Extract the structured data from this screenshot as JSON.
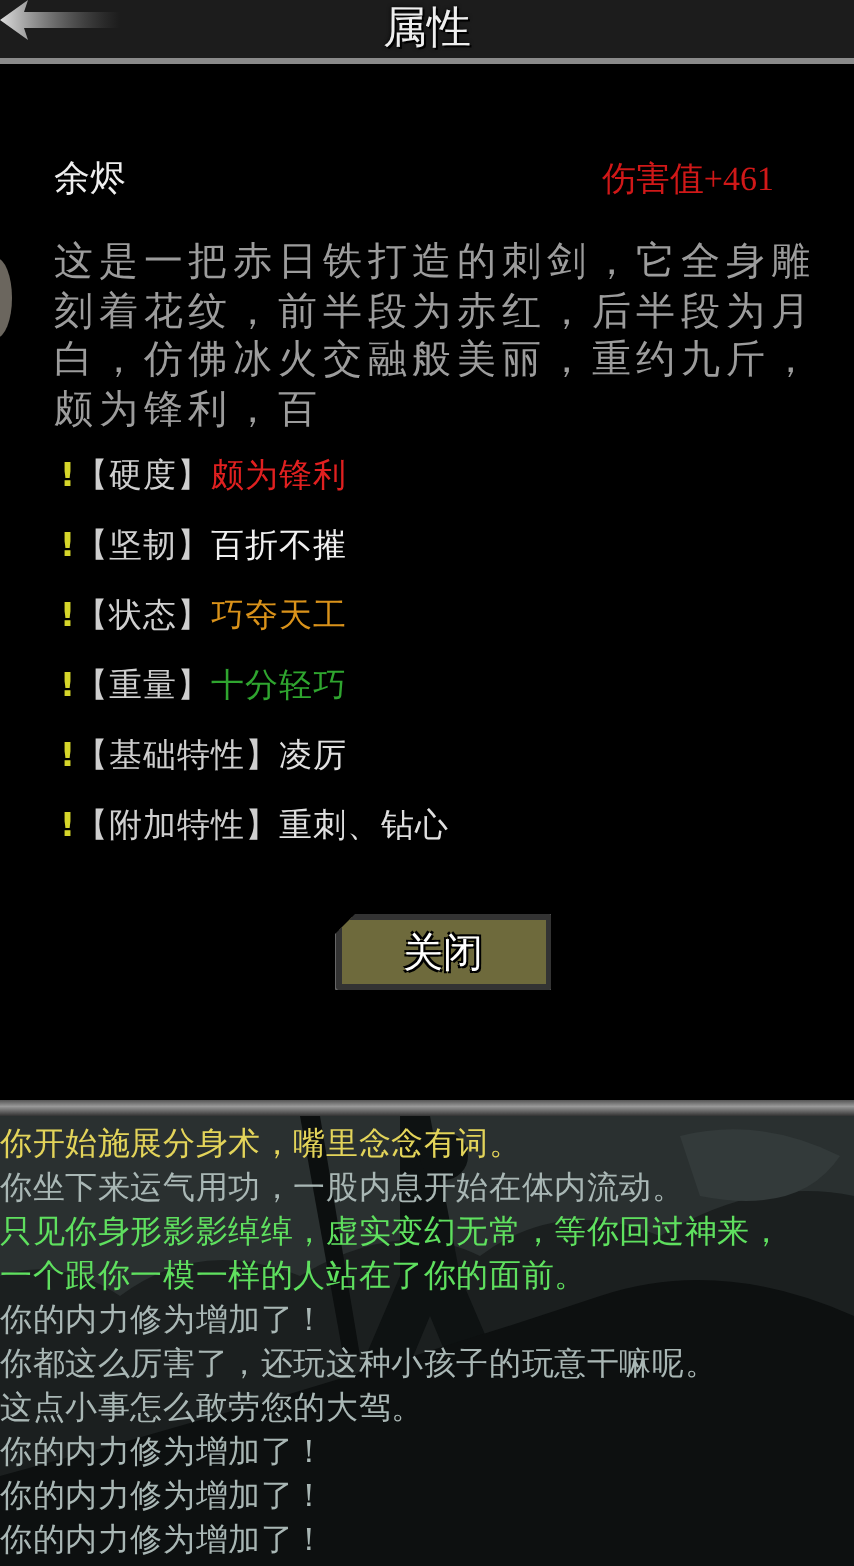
{
  "header": {
    "title": "属性"
  },
  "item": {
    "name": "余烬",
    "damage": "伤害值+461",
    "description": "这是一把赤日铁打造的刺剑，它全身雕刻着花纹，前半段为赤红，后半段为月白，仿佛冰火交融般美丽，重约九斤，颇为锋利，百"
  },
  "attributes": [
    {
      "mark": "!",
      "label": "【硬度】",
      "value": "颇为锋利",
      "color": "#e02020"
    },
    {
      "mark": "!",
      "label": "【坚韧】",
      "value": "百折不摧",
      "color": "#f0f0f0"
    },
    {
      "mark": "!",
      "label": "【状态】",
      "value": "巧夺天工",
      "color": "#d9921a"
    },
    {
      "mark": "!",
      "label": "【重量】",
      "value": "十分轻巧",
      "color": "#2fa52f"
    },
    {
      "mark": "!",
      "label": "【基础特性】",
      "value": "凌厉",
      "color": "#e0e0e0"
    },
    {
      "mark": "!",
      "label": "【附加特性】",
      "value": "重刺、钻心",
      "color": "#e0e0e0"
    }
  ],
  "close_button": "关闭",
  "log": [
    {
      "text": "你开始施展分身术，嘴里念念有词。",
      "color": "#e3d45a"
    },
    {
      "text": "你坐下来运气用功，一股内息开始在体内流动。",
      "color": "#a9b7b5"
    },
    {
      "text": "只见你身形影影绰绰，虚实变幻无常，等你回过神来，",
      "color": "#5fe05f"
    },
    {
      "text": "一个跟你一模一样的人站在了你的面前。",
      "color": "#5fe05f"
    },
    {
      "text": "你的内力修为增加了！",
      "color": "#a9b7b5"
    },
    {
      "text": "你都这么厉害了，还玩这种小孩子的玩意干嘛呢。",
      "color": "#a9b7b5"
    },
    {
      "text": "这点小事怎么敢劳您的大驾。",
      "color": "#a9b7b5"
    },
    {
      "text": "你的内力修为增加了！",
      "color": "#a9b7b5"
    },
    {
      "text": "你的内力修为增加了！",
      "color": "#a9b7b5"
    },
    {
      "text": "你的内力修为增加了！",
      "color": "#a9b7b5"
    }
  ]
}
